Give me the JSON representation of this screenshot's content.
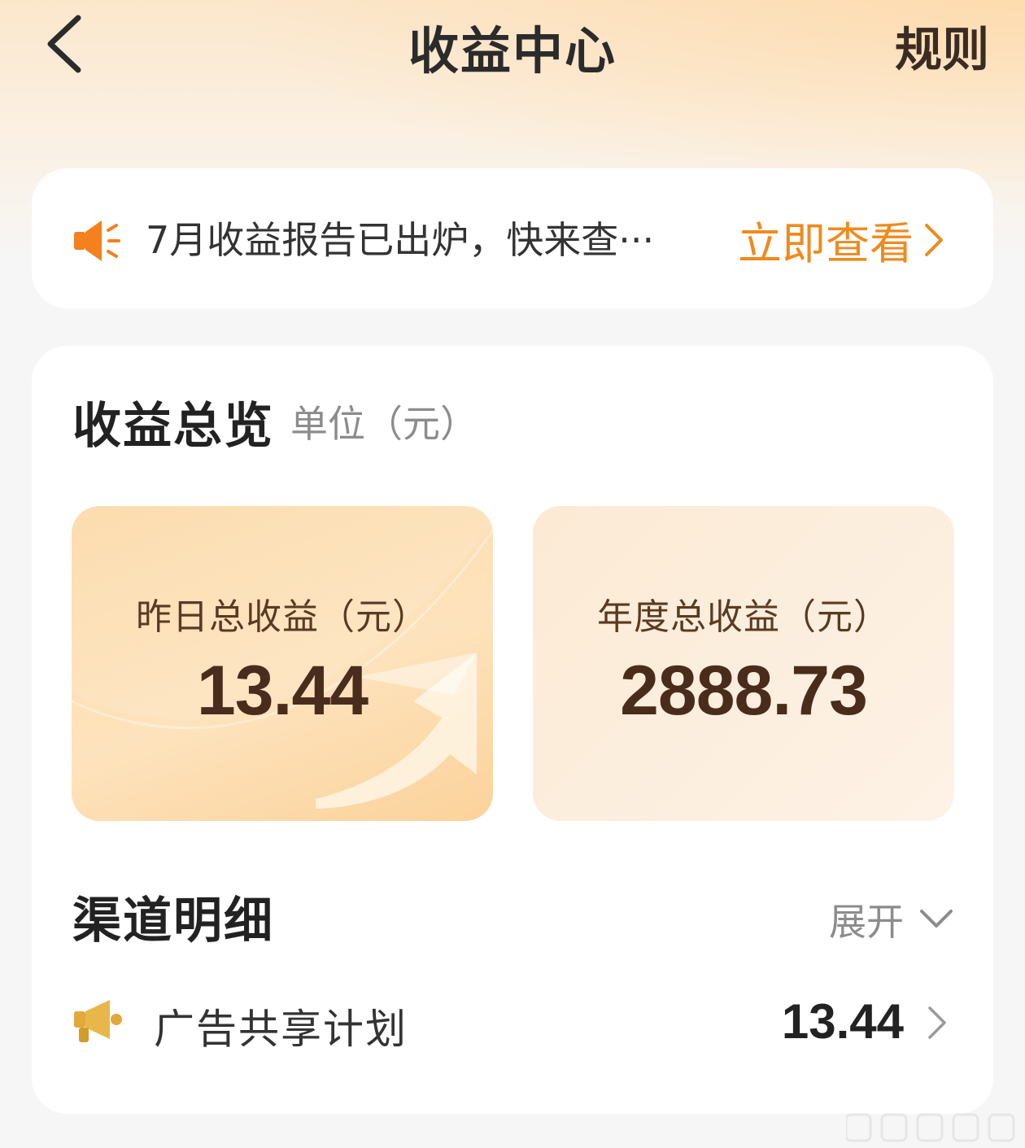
{
  "header": {
    "title": "收益中心",
    "rules_label": "规则",
    "back_icon": "chevron-left-icon"
  },
  "notice": {
    "icon": "megaphone-icon",
    "text": "7月收益报告已出炉，快来查···",
    "action_label": "立即查看",
    "action_icon": "chevron-right-icon",
    "accent_color": "#f08a1e"
  },
  "overview": {
    "title": "收益总览",
    "unit": "单位（元）",
    "yesterday": {
      "label": "昨日总收益（元）",
      "value": "13.44"
    },
    "year": {
      "label": "年度总收益（元）",
      "value": "2888.73"
    }
  },
  "channels": {
    "title": "渠道明细",
    "expand_label": "展开",
    "expand_icon": "chevron-down-icon",
    "items": [
      {
        "icon": "ad-megaphone-icon",
        "name": "广告共享计划",
        "amount": "13.44",
        "chevron": "chevron-right-icon"
      }
    ]
  }
}
